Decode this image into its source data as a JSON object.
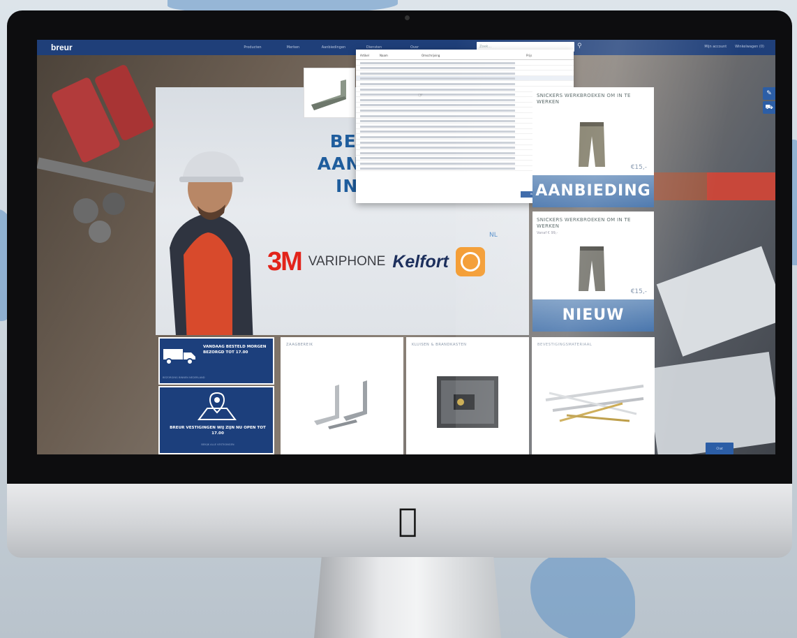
{
  "site": {
    "logo": "breur",
    "nav": [
      "Producten",
      "Merken",
      "Aanbiedingen",
      "Diensten",
      "Over"
    ],
    "search_placeholder": "Zoek...",
    "account_links": [
      "Mijn account",
      "Winkelwagen (0)"
    ]
  },
  "search_dropdown": {
    "columns": [
      "Artikel",
      "Naam",
      "Omschrijving",
      "Prijs"
    ],
    "button": "Bekijk alle resultaten",
    "row_count": 21
  },
  "hero": {
    "title_lines": [
      "BEKIJK ONZE",
      "AANBIEDINGEN",
      "IN DE SHOP"
    ],
    "brands": [
      "3M",
      "VARIPHONE",
      "Kelfort",
      "FEIN"
    ],
    "brand_suffix": "NL"
  },
  "promos": [
    {
      "title": "SNICKERS WERKBROEKEN OM IN TE WERKEN",
      "subtitle": "",
      "price": "€15,-",
      "banner": "AANBIEDING"
    },
    {
      "title": "SNICKERS WERKBROEKEN OM IN TE WERKEN",
      "subtitle": "Vanaf € 99,-",
      "price": "€15,-",
      "banner": "NIEUW"
    }
  ],
  "info": {
    "delivery": {
      "title": "VANDAAG BESTELD MORGEN BEZORGD TOT 17.00",
      "sub": "BEZORGING BINNEN NEDERLAND"
    },
    "stores": {
      "title": "BREUR VESTIGINGEN WIJ ZIJN NU OPEN TOT 17.00",
      "sub": "BEKIJK ALLE VESTIGINGEN"
    }
  },
  "tiles": [
    {
      "title": "ZAAGBEREIK"
    },
    {
      "title": "KLUISEN & BRANDKASTEN"
    },
    {
      "title": "BEVESTIGINGSMATERIAAL"
    }
  ],
  "corner_button": "Chat"
}
